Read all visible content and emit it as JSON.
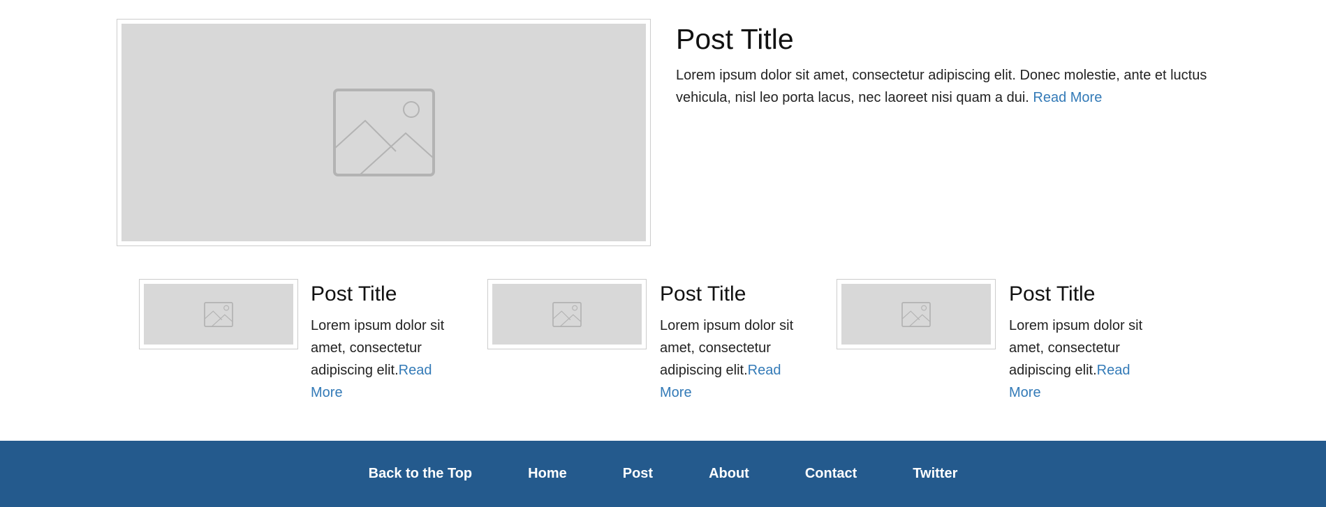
{
  "featured": {
    "image_icon": "image-placeholder-icon",
    "title": "Post Title",
    "body": "Lorem ipsum dolor sit amet, consectetur adipiscing elit. Donec molestie, ante et luctus vehicula, nisl leo porta lacus, nec laoreet nisi quam a dui. ",
    "read_more": "Read More"
  },
  "posts": [
    {
      "image_icon": "image-placeholder-icon",
      "title": "Post Title",
      "body": "Lorem ipsum dolor sit amet, consectetur adipiscing elit.",
      "read_more": "Read More"
    },
    {
      "image_icon": "image-placeholder-icon",
      "title": "Post Title",
      "body": "Lorem ipsum dolor sit amet, consectetur adipiscing elit.",
      "read_more": "Read More"
    },
    {
      "image_icon": "image-placeholder-icon",
      "title": "Post Title",
      "body": "Lorem ipsum dolor sit amet, consectetur adipiscing elit.",
      "read_more": "Read More"
    }
  ],
  "footer": {
    "links": [
      "Back to the Top",
      "Home",
      "Post",
      "About",
      "Contact",
      "Twitter"
    ]
  },
  "colors": {
    "footer_bg": "#245a8d",
    "link": "#337ab7",
    "placeholder_bg": "#d8d8d8",
    "placeholder_icon": "#b3b3b3"
  }
}
